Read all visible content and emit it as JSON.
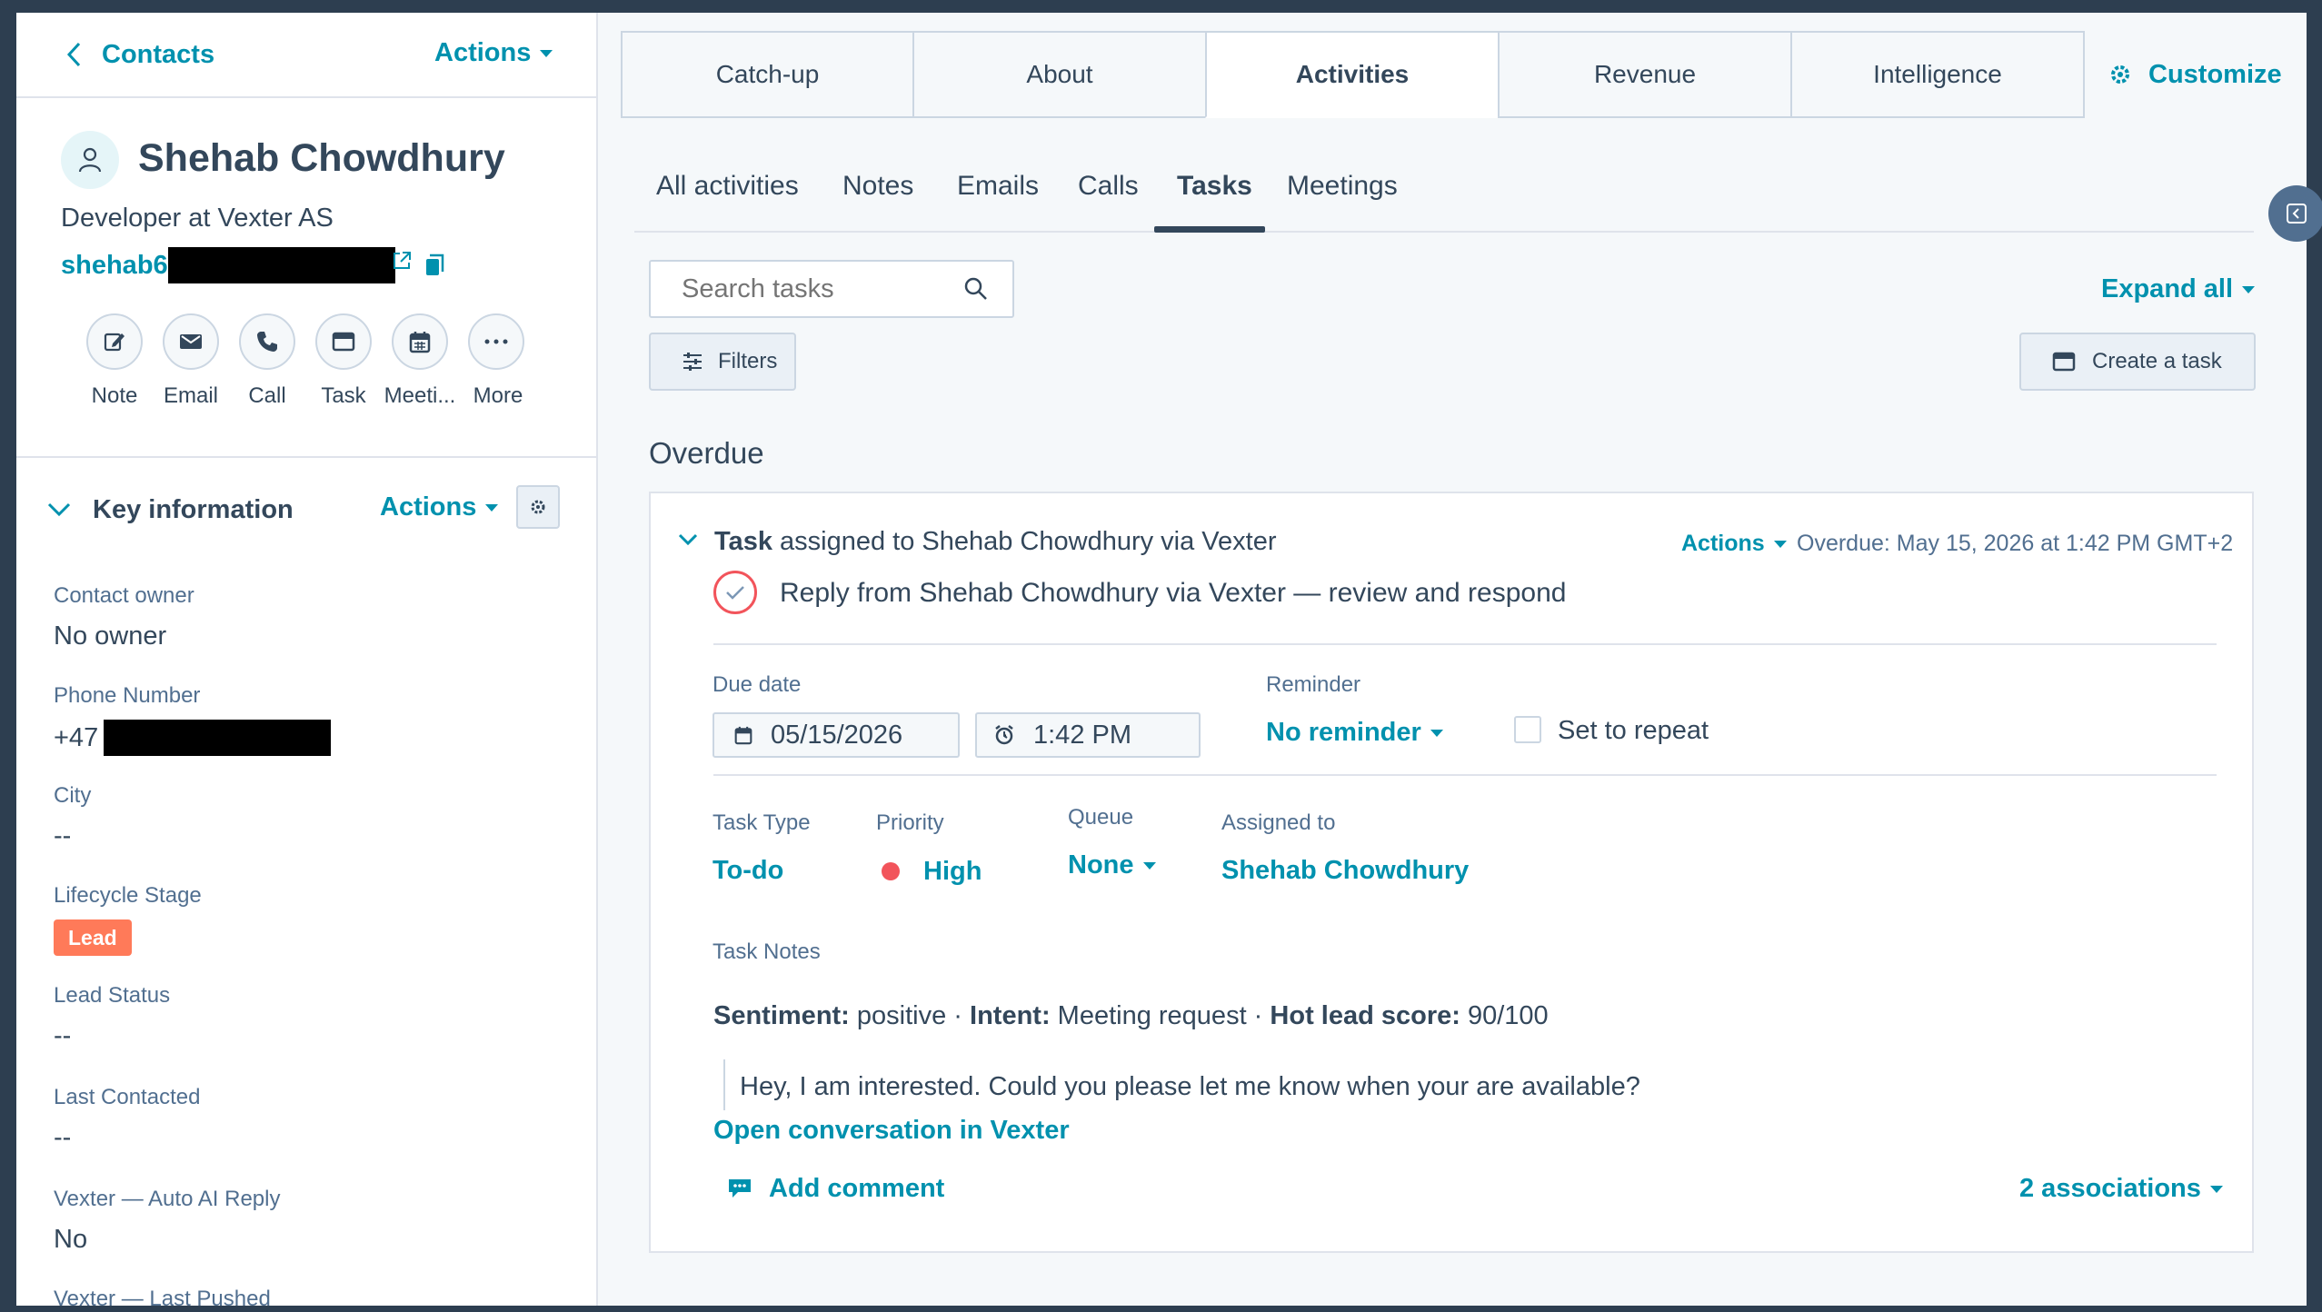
{
  "sidebar": {
    "back_label": "Contacts",
    "actions_label": "Actions",
    "contact": {
      "name": "Shehab Chowdhury",
      "title": "Developer at Vexter AS",
      "email_visible": "shehab6"
    },
    "quick_actions": [
      {
        "label": "Note",
        "icon": "note-icon"
      },
      {
        "label": "Email",
        "icon": "email-icon"
      },
      {
        "label": "Call",
        "icon": "phone-icon"
      },
      {
        "label": "Task",
        "icon": "task-icon"
      },
      {
        "label": "Meeti...",
        "icon": "calendar-icon"
      },
      {
        "label": "More",
        "icon": "more-icon"
      }
    ],
    "key_info": {
      "title": "Key information",
      "actions_label": "Actions",
      "fields": [
        {
          "label": "Contact owner",
          "value": "No owner"
        },
        {
          "label": "Phone Number",
          "value": "+47 4"
        },
        {
          "label": "City",
          "value": "--"
        },
        {
          "label": "Lifecycle Stage",
          "value": "Lead"
        },
        {
          "label": "Lead Status",
          "value": "--"
        },
        {
          "label": "Last Contacted",
          "value": "--"
        },
        {
          "label": "Vexter — Auto AI Reply",
          "value": "No"
        },
        {
          "label": "Vexter — Last Pushed",
          "value": ""
        }
      ]
    }
  },
  "tabs": [
    "Catch-up",
    "About",
    "Activities",
    "Revenue",
    "Intelligence"
  ],
  "active_tab": "Activities",
  "customize_label": "Customize",
  "subtabs": [
    "All activities",
    "Notes",
    "Emails",
    "Calls",
    "Tasks",
    "Meetings"
  ],
  "active_subtab": "Tasks",
  "search": {
    "placeholder": "Search tasks"
  },
  "expand_all_label": "Expand all",
  "filters_label": "Filters",
  "create_task_label": "Create a task",
  "section_title": "Overdue",
  "task": {
    "header_bold": "Task",
    "header_rest": " assigned to Shehab Chowdhury via Vexter",
    "actions_label": "Actions",
    "overdue_text": "Overdue: May 15, 2026 at 1:42 PM GMT+2",
    "title": "Reply from Shehab Chowdhury via Vexter — review and respond",
    "due_date_label": "Due date",
    "due_date": "05/15/2026",
    "due_time": "1:42 PM",
    "reminder_label": "Reminder",
    "reminder_value": "No reminder",
    "repeat_label": "Set to repeat",
    "task_type_label": "Task Type",
    "task_type": "To-do",
    "priority_label": "Priority",
    "priority": "High",
    "queue_label": "Queue",
    "queue": "None",
    "assigned_label": "Assigned to",
    "assigned": "Shehab Chowdhury",
    "notes_label": "Task Notes",
    "notes": {
      "sentiment_label": "Sentiment:",
      "sentiment": " positive · ",
      "intent_label": "Intent:",
      "intent": " Meeting request · ",
      "score_label": "Hot lead score:",
      "score": " 90/100",
      "quote": "Hey, I am interested. Could you please let me know when your are available?",
      "link": "Open conversation in Vexter"
    },
    "add_comment_label": "Add comment",
    "associations_label": "2 associations"
  },
  "colors": {
    "accent": "#0091ae",
    "lead_badge": "#ff7a59",
    "priority_high": "#f2545b",
    "text": "#33475b",
    "frame": "#2d3e50"
  }
}
